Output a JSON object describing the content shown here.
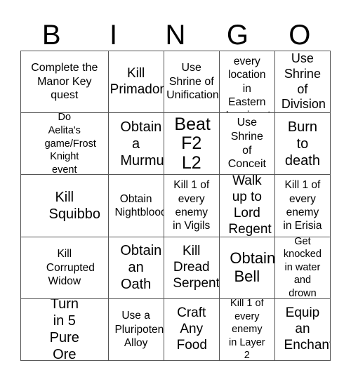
{
  "header": {
    "letters": [
      "B",
      "I",
      "N",
      "G",
      "O"
    ]
  },
  "board": {
    "cells": [
      [
        "Complete the Manor Key quest",
        "Kill Primadon",
        "Use Shrine of Unification",
        "Visit every location in Eastern Luminant",
        "Use Shrine of Division"
      ],
      [
        "Do Aelita's game/Frost Knight event",
        "Obtain a Murmur",
        "Beat F2 L2",
        "Use Shrine of Conceit",
        "Burn to death"
      ],
      [
        "Kill Squibbo",
        "Obtain Nightblood",
        "Kill 1 of every enemy in Vigils",
        "Walk up to Lord Regent",
        "Kill 1 of every enemy in Erisia"
      ],
      [
        "Kill Corrupted Widow",
        "Obtain an Oath",
        "Kill Dread Serpent",
        "Obtain Bell",
        "Get knocked in water and drown"
      ],
      [
        "Turn in 5 Pure Ore",
        "Use a Pluripotent Alloy",
        "Craft Any Food",
        "Kill 1 of every enemy in Layer 2",
        "Equip an Enchant"
      ]
    ]
  }
}
